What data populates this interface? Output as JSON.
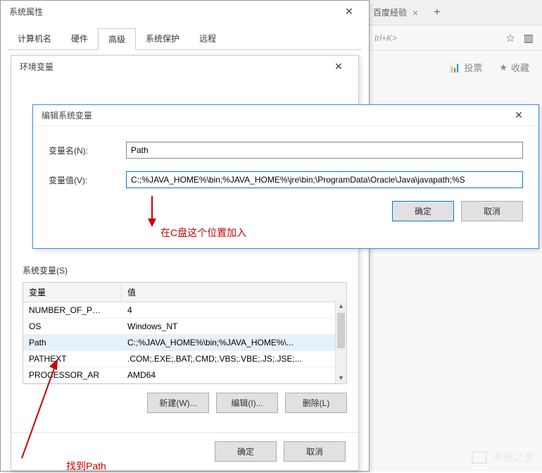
{
  "browser": {
    "tab_title": "百度经验",
    "addr_hint": "trl+K>",
    "vote_label": "投票",
    "favorite_label": "收藏"
  },
  "sys_props": {
    "title": "系统属性",
    "tabs": {
      "computer_name": "计算机名",
      "hardware": "硬件",
      "advanced": "高级",
      "system_protection": "系统保护",
      "remote": "远程"
    }
  },
  "env_vars": {
    "title": "环境变量",
    "system_vars_label": "系统变量(S)",
    "col_var": "变量",
    "col_value": "值",
    "rows": [
      {
        "name": "NUMBER_OF_P…",
        "value": "4"
      },
      {
        "name": "OS",
        "value": "Windows_NT"
      },
      {
        "name": "Path",
        "value": "C:;%JAVA_HOME%\\bin;%JAVA_HOME%\\..."
      },
      {
        "name": "PATHEXT",
        "value": ".COM;.EXE;.BAT;.CMD;.VBS;.VBE;.JS;.JSE;..."
      },
      {
        "name": "PROCESSOR_AR",
        "value": "AMD64"
      }
    ],
    "btn_new": "新建(W)...",
    "btn_edit": "编辑(I)...",
    "btn_delete": "删除(L)",
    "btn_ok": "确定",
    "btn_cancel": "取消"
  },
  "edit_dialog": {
    "title": "编辑系统变量",
    "name_label": "变量名(N):",
    "name_value": "Path",
    "value_label": "变量值(V):",
    "value_value": "C:;%JAVA_HOME%\\bin;%JAVA_HOME%\\jre\\bin;\\ProgramData\\Oracle\\Java\\javapath;%S",
    "btn_ok": "确定",
    "btn_cancel": "取消"
  },
  "annotations": {
    "insert_here": "在C盘这个位置加入",
    "find_path": "找到Path"
  },
  "watermark": "系统之家"
}
